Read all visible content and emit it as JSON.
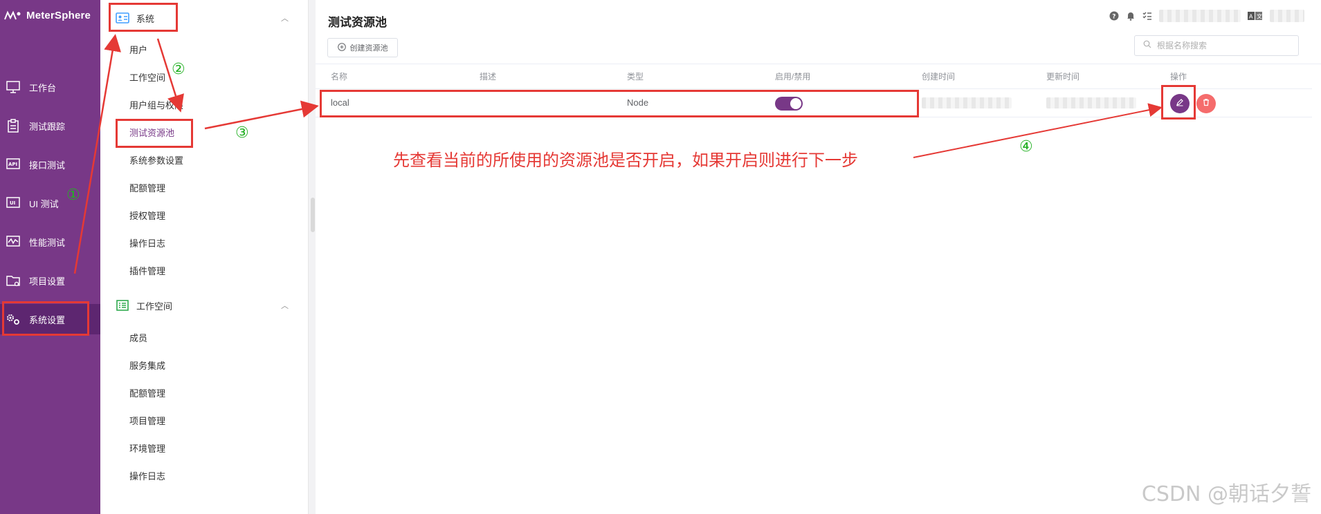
{
  "app": {
    "name": "MeterSphere"
  },
  "leftnav": {
    "items": [
      {
        "label": "工作台",
        "icon": "monitor-icon"
      },
      {
        "label": "测试跟踪",
        "icon": "clipboard-icon"
      },
      {
        "label": "接口测试",
        "icon": "api-icon"
      },
      {
        "label": "UI 测试",
        "icon": "ui-icon"
      },
      {
        "label": "性能测试",
        "icon": "performance-icon"
      },
      {
        "label": "项目设置",
        "icon": "folder-gear-icon"
      },
      {
        "label": "系统设置",
        "icon": "gears-icon",
        "active": true
      }
    ]
  },
  "submenu": {
    "groups": [
      {
        "label": "系统",
        "items": [
          "用户",
          "工作空间",
          "用户组与权限",
          "测试资源池",
          "系统参数设置",
          "配额管理",
          "授权管理",
          "操作日志",
          "插件管理"
        ],
        "active_item": "测试资源池"
      },
      {
        "label": "工作空间",
        "items": [
          "成员",
          "服务集成",
          "配额管理",
          "项目管理",
          "环境管理",
          "操作日志"
        ]
      }
    ]
  },
  "main": {
    "title": "测试资源池",
    "create_button": "创建资源池",
    "search_placeholder": "根据名称搜索",
    "columns": [
      "名称",
      "描述",
      "类型",
      "启用/禁用",
      "创建时间",
      "更新时间",
      "操作"
    ],
    "rows": [
      {
        "name": "local",
        "description": "",
        "type": "Node",
        "enabled": true
      }
    ]
  },
  "annotations": {
    "step1": "①",
    "step2": "②",
    "step3": "③",
    "step4": "④",
    "note": "先查看当前的所使用的资源池是否开启，如果开启则进行下一步",
    "watermark": "CSDN @朝话夕誓"
  },
  "colors": {
    "brand": "#783887",
    "danger": "#f56c6c",
    "annotation": "#e53935",
    "step": "#23b023"
  }
}
